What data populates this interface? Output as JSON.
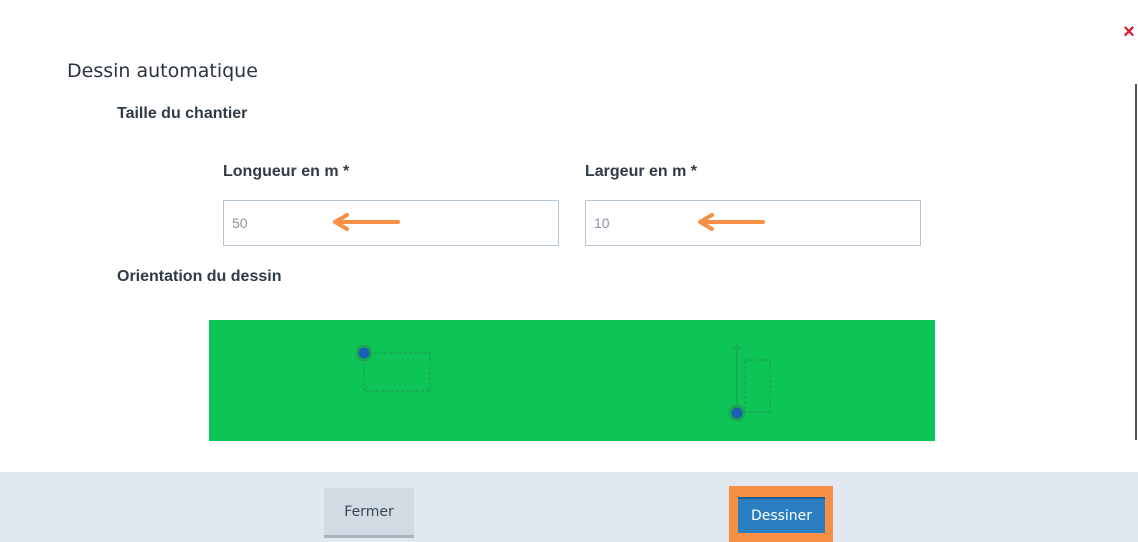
{
  "modal": {
    "title": "Dessin automatique",
    "close_symbol": "×"
  },
  "size_section": {
    "title": "Taille du chantier",
    "length": {
      "label": "Longueur en m *",
      "value": "50"
    },
    "width": {
      "label": "Largeur en m *",
      "value": "10"
    }
  },
  "orientation_section": {
    "title": "Orientation du dessin",
    "background_color": "#0dc457",
    "options": [
      {
        "name": "horizontal",
        "icon": "horizontal-orientation-icon"
      },
      {
        "name": "vertical",
        "icon": "vertical-orientation-icon"
      }
    ]
  },
  "annotations": {
    "arrow_color": "#f78f45",
    "highlight_color": "#f78f45"
  },
  "footer": {
    "close_label": "Fermer",
    "draw_label": "Dessiner"
  }
}
